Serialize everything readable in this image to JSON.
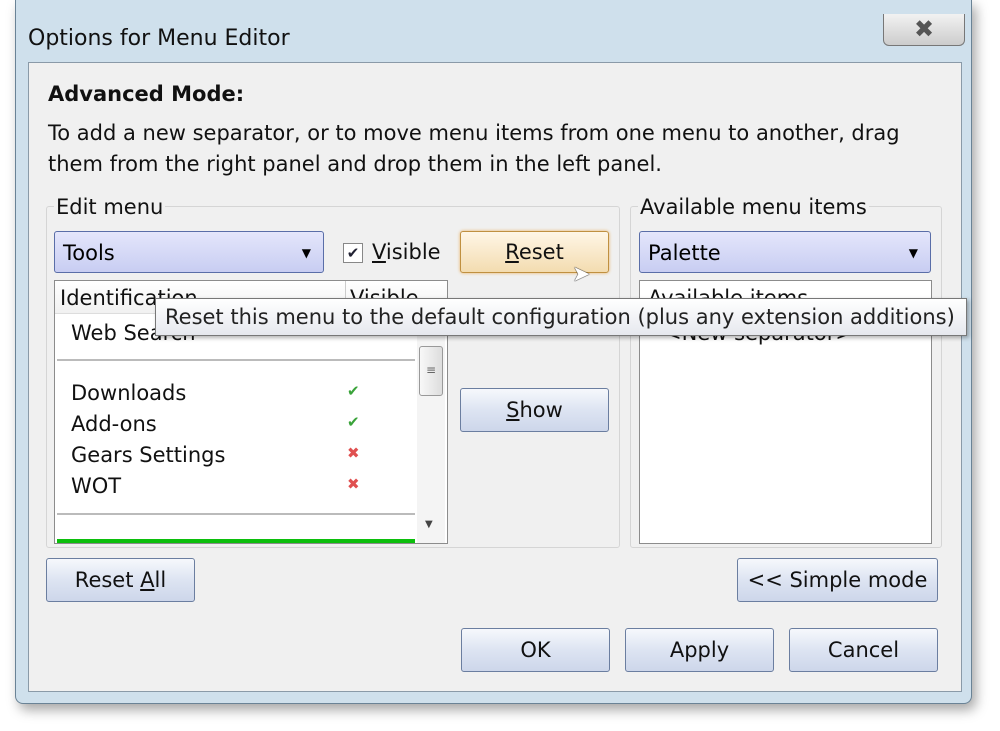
{
  "window": {
    "title": "Options for Menu Editor",
    "close_icon": "close-icon"
  },
  "intro": {
    "heading": "Advanced Mode:",
    "line1": "To add a new separator, or to move menu items from one menu to another, drag",
    "line2": "them from the right panel and drop them in the left panel."
  },
  "edit": {
    "label": "Edit menu",
    "menu_value": "Tools",
    "visible_label": "Visible",
    "visible_checked": true,
    "reset": "Reset",
    "show": "Show",
    "columns": [
      "Identification",
      "Visible"
    ],
    "rows": [
      {
        "label": "Web Search",
        "visible": null
      },
      {
        "label": "Downloads",
        "visible": true
      },
      {
        "label": "Add-ons",
        "visible": true
      },
      {
        "label": "Gears Settings",
        "visible": false
      },
      {
        "label": "WOT",
        "visible": false
      }
    ],
    "colors": {
      "check": "#3aa33a",
      "cross": "#e05050",
      "selected_row": "#0cbf0c"
    }
  },
  "available": {
    "label": "Available menu items",
    "menu_value": "Palette",
    "column": "Available items",
    "items": [
      "<New separator>"
    ]
  },
  "buttons": {
    "reset_all": "Reset All",
    "simple_mode": "<< Simple mode",
    "ok": "OK",
    "apply": "Apply",
    "cancel": "Cancel"
  },
  "tooltip": "Reset this menu to the default configuration (plus any extension additions)"
}
